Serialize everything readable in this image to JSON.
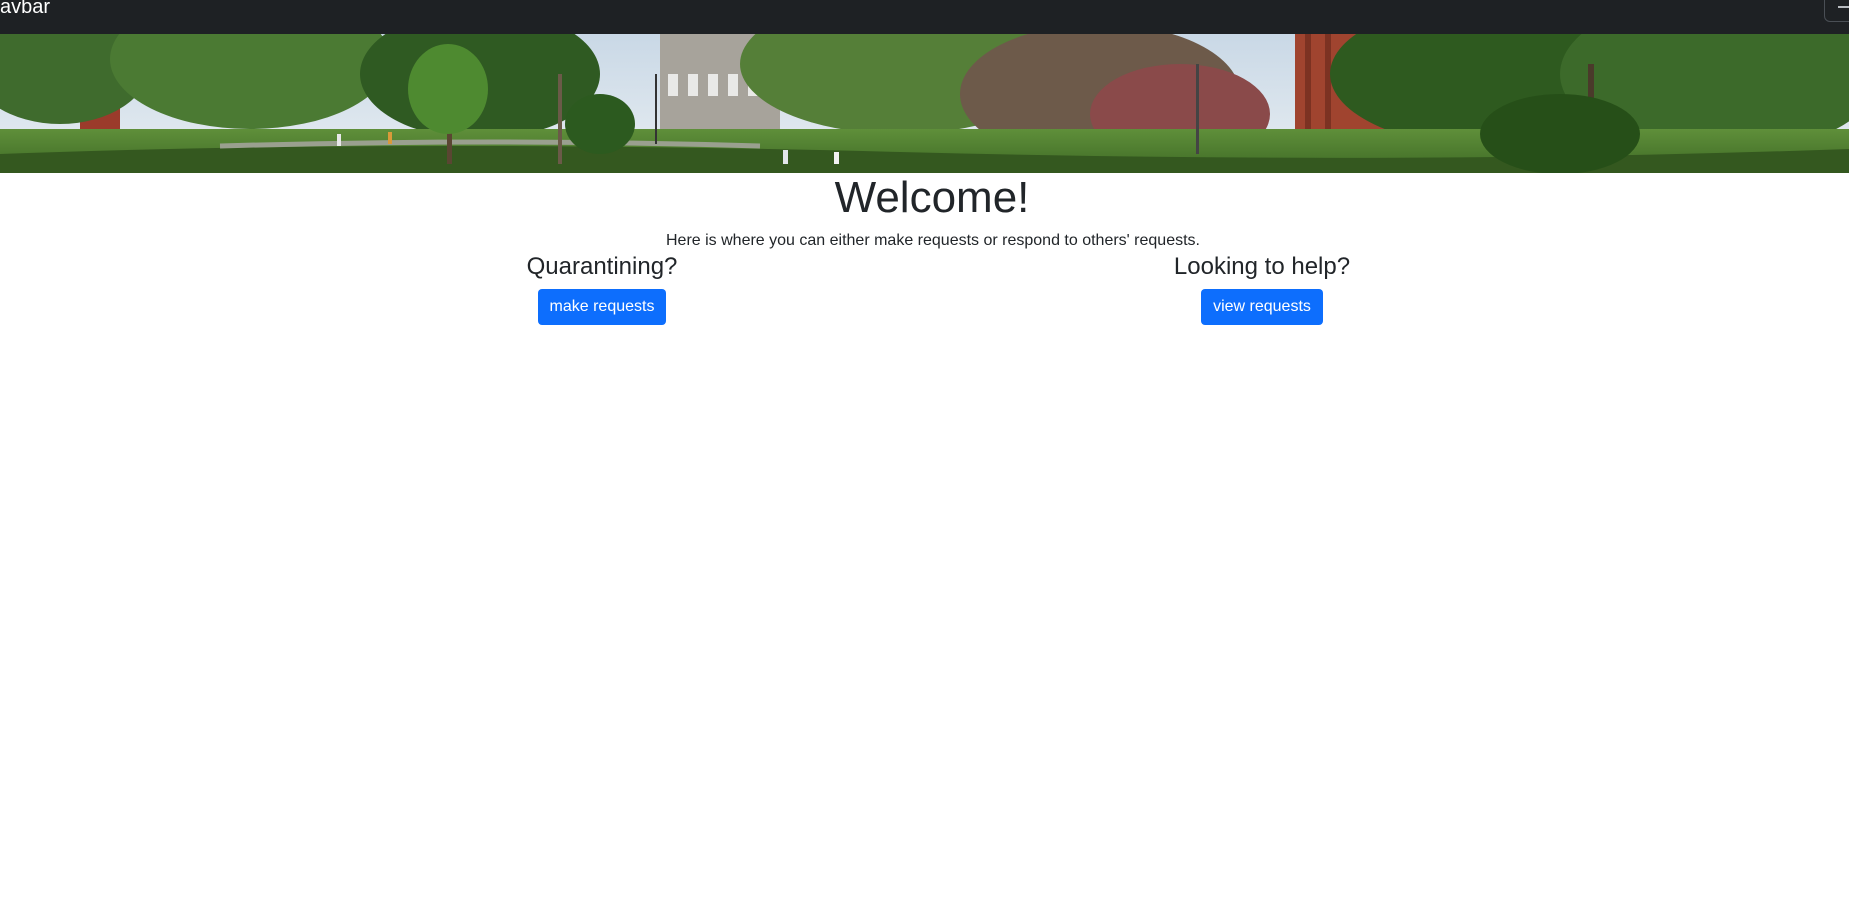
{
  "navbar": {
    "brand": "avbar",
    "toggler_icon": "hamburger-icon"
  },
  "banner": {
    "image": "campus-landscape-photo"
  },
  "main": {
    "title": "Welcome!",
    "subtitle": "Here is where you can either make requests or respond to others' requests.",
    "left": {
      "heading": "Quarantining?",
      "button_label": "make requests"
    },
    "right": {
      "heading": "Looking to help?",
      "button_label": "view requests"
    }
  },
  "colors": {
    "navbar_bg": "#1e2124",
    "primary_button": "#0d6efd",
    "text": "#212529"
  }
}
